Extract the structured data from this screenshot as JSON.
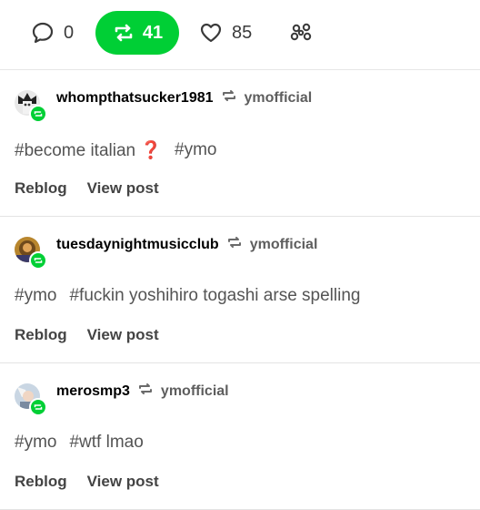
{
  "tabs": {
    "replies": {
      "icon": "speech-bubble-icon",
      "count": "0"
    },
    "reblogs": {
      "icon": "reblog-icon",
      "count": "41",
      "active_color": "#00cf35"
    },
    "likes": {
      "icon": "heart-icon",
      "count": "85"
    },
    "more": {
      "icon": "community-dots-icon"
    }
  },
  "notes": [
    {
      "username": "whompthatsucker1981",
      "source": "ymofficial",
      "avatar_icon": "user-avatar",
      "tags": [
        "#become italian ❓",
        "#ymo"
      ],
      "reblog_label": "Reblog",
      "view_label": "View post"
    },
    {
      "username": "tuesdaynightmusicclub",
      "source": "ymofficial",
      "avatar_icon": "user-avatar",
      "tags": [
        "#ymo",
        "#fuckin yoshihiro togashi arse spelling"
      ],
      "reblog_label": "Reblog",
      "view_label": "View post"
    },
    {
      "username": "merosmp3",
      "source": "ymofficial",
      "avatar_icon": "user-avatar",
      "tags": [
        "#ymo",
        "#wtf lmao"
      ],
      "reblog_label": "Reblog",
      "view_label": "View post"
    }
  ],
  "colors": {
    "accent_green": "#00cf35",
    "text_gray": "#545454"
  }
}
